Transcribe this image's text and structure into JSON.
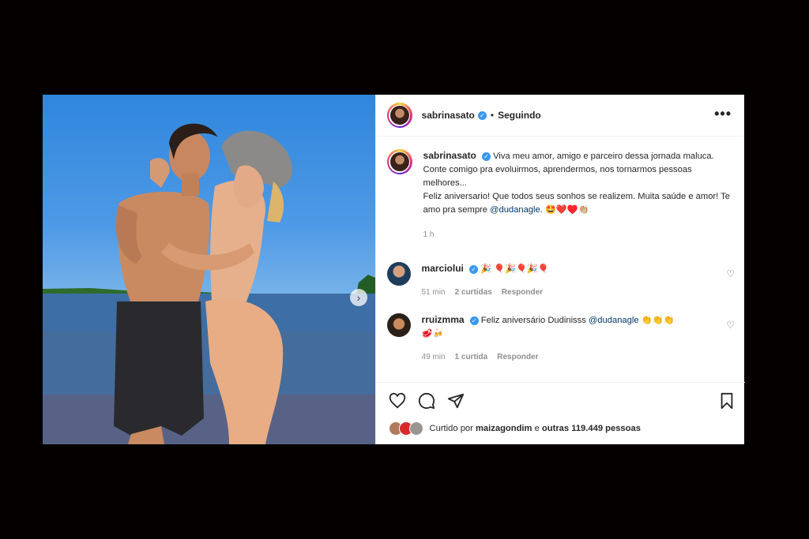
{
  "post": {
    "author": "sabrinasato",
    "follow_status": "Seguindo",
    "separator": "•",
    "more_label": "•••",
    "caption": {
      "author": "sabrinasato",
      "line1": "Viva meu amor, amigo e parceiro dessa jornada maluca. Conte comigo pra evoluirmos, aprendermos, nos tornarmos pessoas melhores...",
      "line2": "Feliz aniversario! Que todos seus sonhos se realizem. Muita saúde e amor! Te amo pra sempre",
      "mention": "@dudanagle",
      "emojis": ". 🤩❤️♥️👏🏼",
      "time": "1 h"
    },
    "comments": [
      {
        "user": "marciolui",
        "text": "🎉 🎈🎉🎈🎉🎈",
        "time": "51 min",
        "likes": "2 curtidas",
        "reply": "Responder"
      },
      {
        "user": "rruizmma",
        "text": "Feliz aniversário Dudinisss",
        "mention": "@dudanagle",
        "emojis": "👏👏👏",
        "emojis2": "🥩🍻",
        "time": "49 min",
        "likes": "1 curtida",
        "reply": "Responder"
      }
    ],
    "liked_by_prefix": "Curtido por",
    "liked_by_user": "maizagondim",
    "liked_by_middle": "e",
    "liked_by_others": "outras 119.449 pessoas",
    "icons": [
      "heart-icon",
      "comment-icon",
      "share-icon",
      "bookmark-icon",
      "chevron-right-icon",
      "ellipsis-icon",
      "verified-icon"
    ],
    "colors": {
      "verified": "#3897f0",
      "mention": "#00376b",
      "muted": "#8e8e8e"
    }
  }
}
